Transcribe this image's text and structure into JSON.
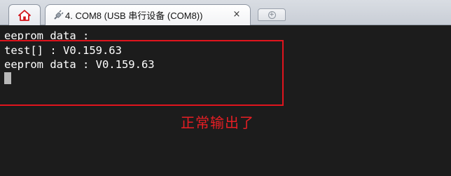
{
  "tabs": {
    "home_icon": "home-icon",
    "session": {
      "icon": "plug-icon",
      "title": "4. COM8  (USB 串行设备 (COM8))",
      "close_glyph": "×"
    },
    "new_tab_glyph": "+"
  },
  "terminal": {
    "lines": [
      "eeprom data :",
      "test[] : V0.159.63",
      "eeprom data : V0.159.63"
    ]
  },
  "annotation": {
    "text": "正常输出了",
    "color": "#e61e24"
  },
  "colors": {
    "terminal_bg": "#1c1c1c",
    "terminal_fg": "#ffffff",
    "highlight": "#e0141d"
  }
}
